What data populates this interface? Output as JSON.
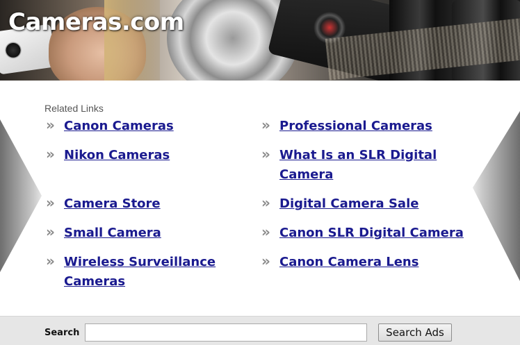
{
  "header": {
    "site_title": "Cameras.com"
  },
  "related": {
    "heading": "Related Links",
    "arrow_glyph": "»",
    "left": [
      {
        "lines": [
          "Canon Cameras"
        ]
      },
      {
        "lines": [
          "Nikon Cameras"
        ]
      },
      {
        "lines": [
          "Camera Store"
        ]
      },
      {
        "lines": [
          "Small Camera"
        ]
      },
      {
        "lines": [
          "Wireless Surveillance",
          "Cameras"
        ]
      }
    ],
    "right": [
      {
        "lines": [
          "Professional Cameras"
        ]
      },
      {
        "lines": [
          "What Is an SLR Digital",
          "Camera"
        ]
      },
      {
        "lines": [
          "Digital Camera Sale"
        ]
      },
      {
        "lines": [
          "Canon SLR Digital Camera"
        ]
      },
      {
        "lines": [
          "Canon Camera Lens"
        ]
      }
    ]
  },
  "search": {
    "label": "Search",
    "input_value": "",
    "button_label": "Search Ads"
  },
  "colors": {
    "link": "#1a1a8f",
    "search_bar_bg": "#e6e6e6"
  }
}
